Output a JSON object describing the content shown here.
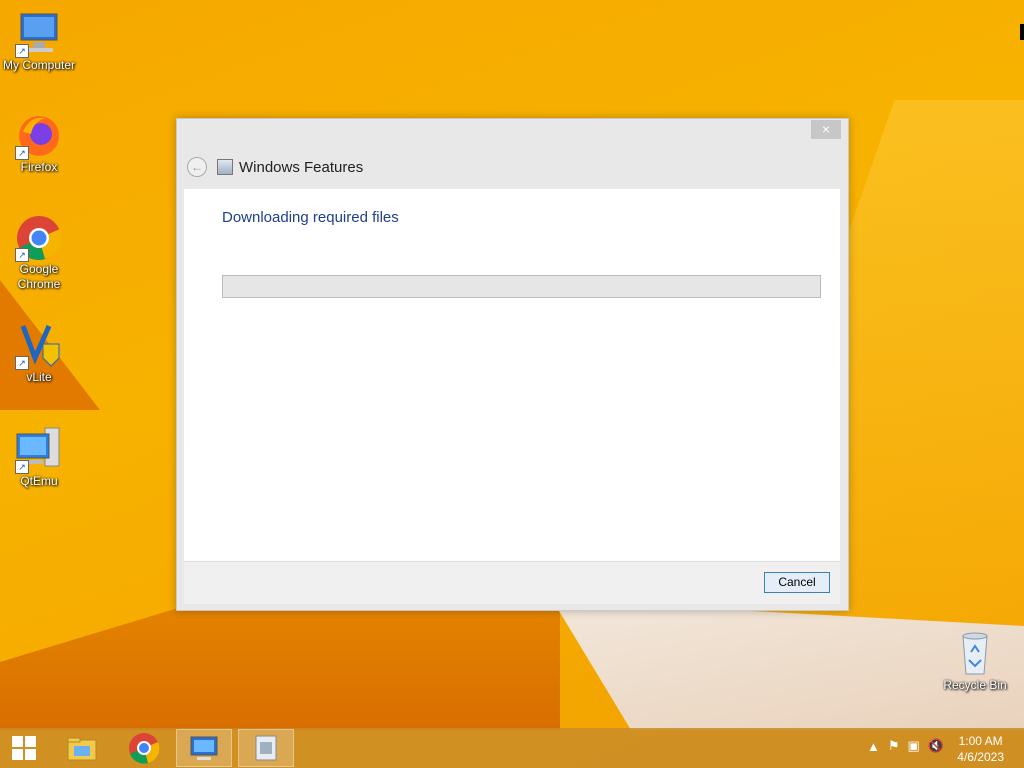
{
  "desktop": {
    "icons": [
      {
        "label": "My Computer"
      },
      {
        "label": "Firefox"
      },
      {
        "label": "Google Chrome"
      },
      {
        "label": "vLite"
      },
      {
        "label": "QtEmu"
      },
      {
        "label": "Recycle Bin"
      }
    ]
  },
  "dialog": {
    "title": "Windows Features",
    "heading": "Downloading required files",
    "progress": 0,
    "cancel_label": "Cancel",
    "close_glyph": "×",
    "back_glyph": "←"
  },
  "taskbar": {
    "buttons": [
      "start-icon",
      "file-explorer-icon",
      "chrome-icon",
      "desktop-app-icon",
      "windows-features-icon"
    ]
  },
  "tray": {
    "time": "1:00 AM",
    "date": "4/6/2023"
  },
  "colors": {
    "accent": "#1e3f8a",
    "desktop": "#f5a800",
    "taskbar": "#c98c28"
  }
}
